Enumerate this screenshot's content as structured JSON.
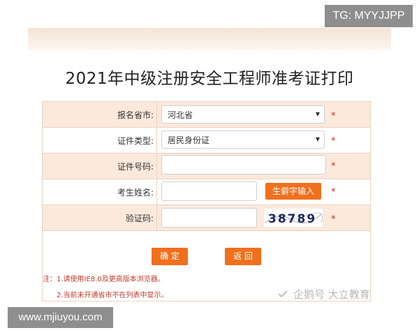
{
  "badges": {
    "top_right": "TG: MYYJJPP",
    "bottom_left": "www.mjiuyou.com"
  },
  "page": {
    "title": "2021年中级注册安全工程师准考证打印"
  },
  "form": {
    "province_label": "报名省市:",
    "province_value": "河北省",
    "id_type_label": "证件类型:",
    "id_type_value": "居民身份证",
    "id_number_label": "证件号码:",
    "id_number_value": "",
    "name_label": "考生姓名:",
    "name_value": "",
    "rare_char_button": "生僻字输入",
    "captcha_label": "验证码:",
    "captcha_value": "",
    "captcha_text": "38789",
    "required_mark": "*",
    "confirm_button": "确 定",
    "back_button": "返 回"
  },
  "notes": {
    "line1": "注：1.请使用IE8.0及更高版本浏览器。",
    "line2": "2.当前未开通省市不在列表中显示。"
  },
  "watermark": {
    "text": "企鹅号 大立教育"
  },
  "colors": {
    "accent": "#f0701e",
    "row_bg": "#fbe9dc",
    "required": "#e2231a"
  }
}
